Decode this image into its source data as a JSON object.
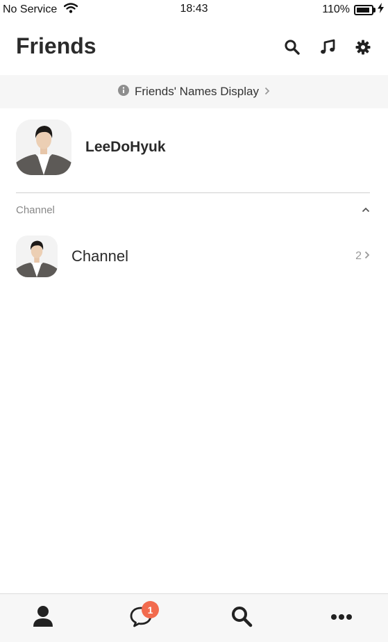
{
  "status_bar": {
    "carrier": "No Service",
    "time": "18:43",
    "battery": "110%",
    "battery_level": 1.0
  },
  "header": {
    "title": "Friends",
    "icons": [
      "search-icon",
      "music-note-icon",
      "gear-icon"
    ]
  },
  "notice": {
    "text": "Friends' Names Display",
    "icons": [
      "info-icon",
      "chevron-right-icon"
    ]
  },
  "profile": {
    "name": "LeeDoHyuk",
    "avatar": "profile-photo"
  },
  "channel_section": {
    "label": "Channel",
    "rows": [
      {
        "name": "Channel",
        "count": "2"
      }
    ]
  },
  "tab_bar": {
    "tabs": [
      "person-icon",
      "chat-bubble-icon",
      "search-icon",
      "more-icon"
    ],
    "chat_badge": "1"
  },
  "colors": {
    "accent_badge": "#f26b4e",
    "text_dark": "#2b2b2b",
    "muted": "#888888"
  }
}
